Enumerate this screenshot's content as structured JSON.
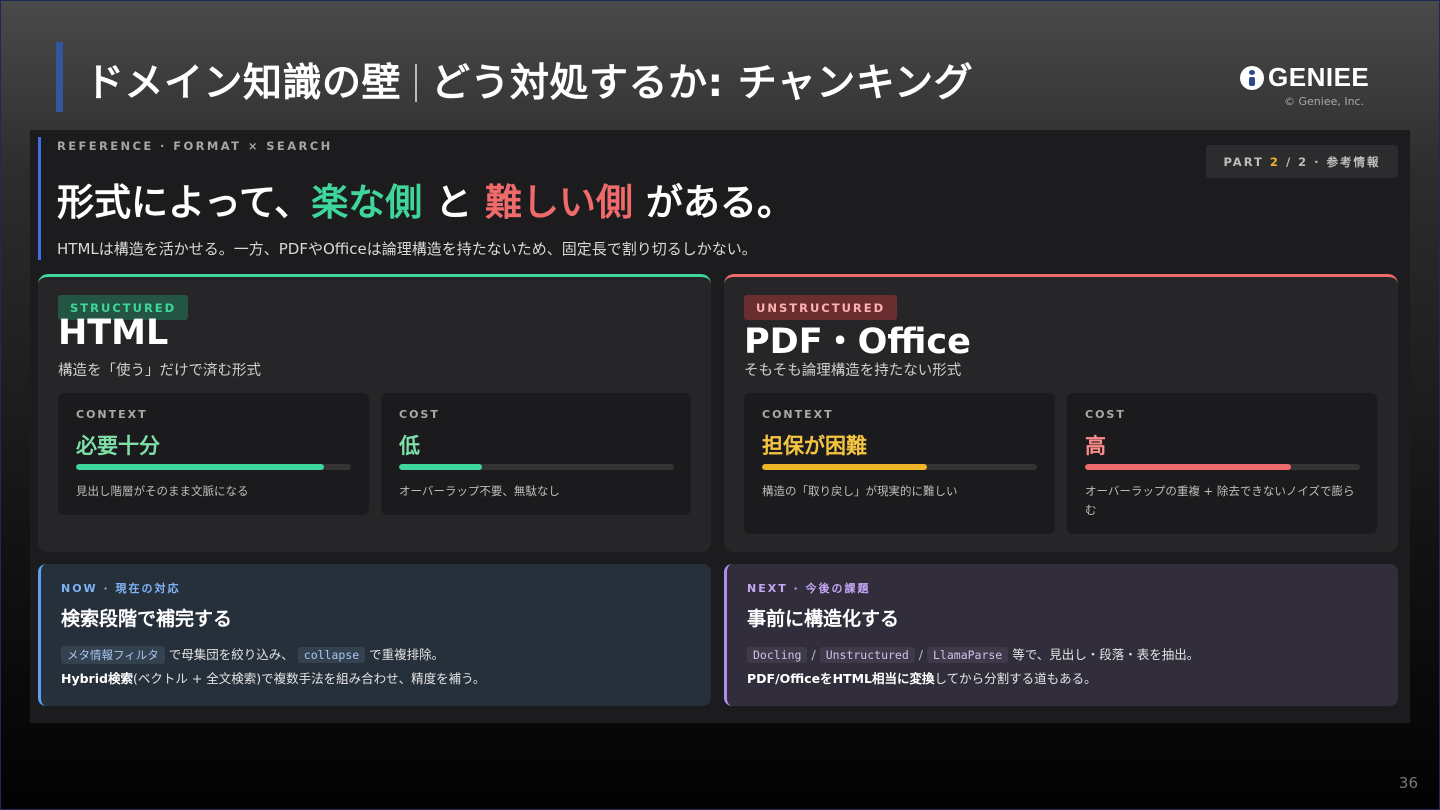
{
  "slide": {
    "title_part1": "ドメイン知識の壁",
    "title_part2": "どう対処するか: チャンキング",
    "logo_text": "GENIEE",
    "copyright": "© Geniee, Inc.",
    "page_number": "36"
  },
  "header": {
    "reference_label": "REFERENCE · FORMAT × SEARCH",
    "part_prefix": "PART",
    "part_current": "2",
    "part_suffix": "/ 2 · 参考情報",
    "headline_a": "形式によって、",
    "headline_easy": "楽な側",
    "headline_b": " と ",
    "headline_hard": "難しい側",
    "headline_c": " がある。",
    "lead": "HTMLは構造を活かせる。一方、PDFやOfficeは論理構造を持たないため、固定長で割り切るしかない。"
  },
  "cards": {
    "structured": {
      "tag": "STRUCTURED",
      "title": "HTML",
      "subtitle": "構造を「使う」だけで済む形式",
      "context": {
        "label": "CONTEXT",
        "value": "必要十分",
        "level": 0.9,
        "desc": "見出し階層がそのまま文脈になる"
      },
      "cost": {
        "label": "COST",
        "value": "低",
        "level": 0.3,
        "desc": "オーバーラップ不要、無駄なし"
      }
    },
    "unstructured": {
      "tag": "UNSTRUCTURED",
      "title": "PDF・Office",
      "subtitle": "そもそも論理構造を持たない形式",
      "context": {
        "label": "CONTEXT",
        "value": "担保が困難",
        "level": 0.6,
        "desc": "構造の「取り戻し」が現実的に難しい"
      },
      "cost": {
        "label": "COST",
        "value": "高",
        "level": 0.75,
        "desc": "オーバーラップの重複 + 除去できないノイズで膨らむ"
      }
    }
  },
  "now": {
    "label": "NOW · 現在の対応",
    "title": "検索段階で補完する",
    "code1": "メタ情報フィルタ",
    "text1": "で母集団を絞り込み、",
    "code2": "collapse",
    "text2": "で重複排除。",
    "bold": "Hybrid検索",
    "text3": "(ベクトル + 全文検索)で複数手法を組み合わせ、精度を補う。"
  },
  "next": {
    "label": "NEXT · 今後の課題",
    "title": "事前に構造化する",
    "code1": "Docling",
    "code2": "Unstructured",
    "code3": "LlamaParse",
    "text1": "等で、見出し・段落・表を抽出。",
    "bold": "PDF/OfficeをHTML相当に変換",
    "text2": "してから分割する道もある。"
  },
  "colors": {
    "green": "#3ed69a",
    "red": "#ef6a6a",
    "yellow": "#f0b429",
    "blue": "#5ba0f0",
    "purple": "#b08bf0"
  }
}
